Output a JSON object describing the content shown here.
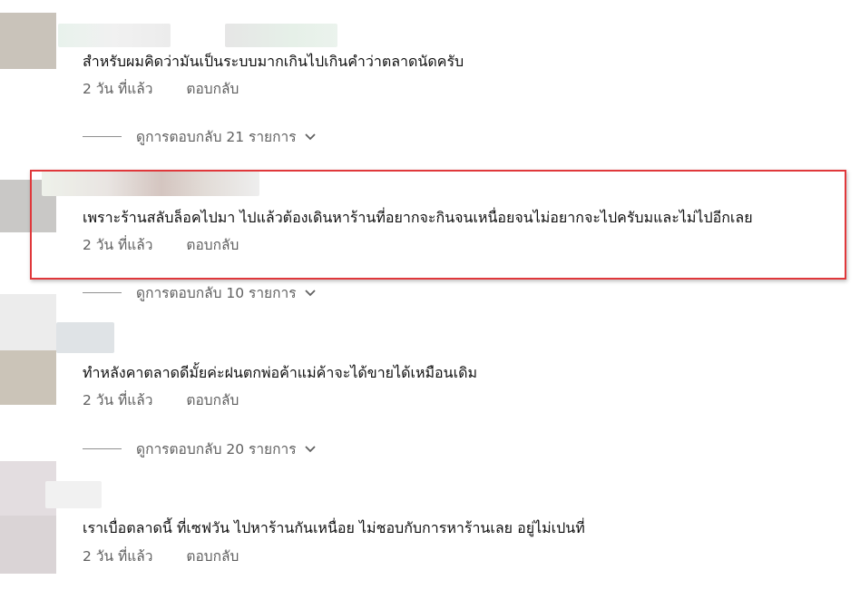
{
  "comments": [
    {
      "text": "สำหรับผมคิดว่ามันเป็นระบบมากเกินไปเกินคำว่าตลาดนัดครับ",
      "time": "2 วัน ที่แล้ว",
      "reply_label": "ตอบกลับ",
      "view_replies": "ดูการตอบกลับ 21 รายการ"
    },
    {
      "text": "เพราะร้านสลับล็อคไปมา ไปแล้วต้องเดินหาร้านที่อยากจะกินจนเหนื่อยจนไม่อยากจะไปครับมและไม่ไปอีกเลย",
      "time": "2 วัน ที่แล้ว",
      "reply_label": "ตอบกลับ",
      "view_replies": "ดูการตอบกลับ 10 รายการ"
    },
    {
      "text": "ทำหลังคาตลาดดีมั้ยค่ะฝนตกพ่อค้าแม่ค้าจะได้ขายได้เหมือนเดิม",
      "time": "2 วัน ที่แล้ว",
      "reply_label": "ตอบกลับ",
      "view_replies": "ดูการตอบกลับ 20 รายการ"
    },
    {
      "text": "เราเบื่อตลาดนี้ ที่เซฟวัน ไปหาร้านกันเหนื่อย ไม่ชอบกับการหาร้านเลย อยู่ไม่เปนที่",
      "time": "2 วัน ที่แล้ว",
      "reply_label": "ตอบกลับ"
    }
  ],
  "colors": {
    "highlight_border": "#e0383b",
    "meta_text": "#606060",
    "text": "#0f0f0f"
  }
}
